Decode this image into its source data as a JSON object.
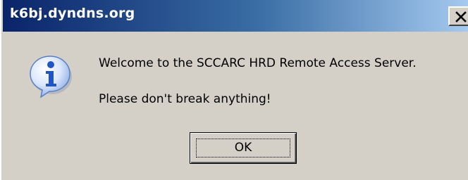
{
  "window": {
    "title": "k6bj.dyndns.org",
    "close_icon": "close-icon"
  },
  "dialog": {
    "icon": "info-icon",
    "message_line_1": "Welcome to the SCCARC HRD Remote Access Server.",
    "message_line_2": "Please don't break anything!",
    "ok_label": "OK"
  },
  "colors": {
    "titlebar_start": "#0a246a",
    "titlebar_end": "#a6caf0",
    "dialog_face": "#d4d0c8",
    "icon_blue": "#2a64c8"
  }
}
